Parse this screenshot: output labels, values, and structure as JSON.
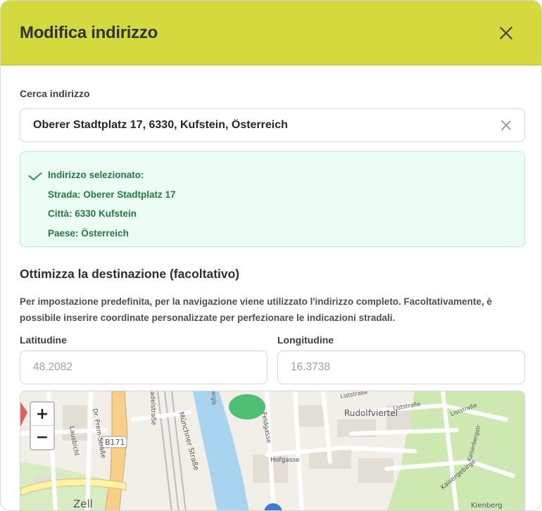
{
  "header": {
    "title": "Modifica indirizzo"
  },
  "search": {
    "label": "Cerca indirizzo",
    "value": "Oberer Stadtplatz 17, 6330, Kufstein, Österreich"
  },
  "selected": {
    "heading": "Indirizzo selezionato:",
    "street": "Strada: Oberer Stadtplatz 17",
    "city": "Città: 6330 Kufstein",
    "country": "Paese: Österreich"
  },
  "refine": {
    "title": "Ottimizza la destinazione (facoltativo)",
    "description": "Per impostazione predefinita, per la navigazione viene utilizzato l'indirizzo completo. Facoltativamente, è possibile inserire coordinate personalizzate per perfezionare le indicazioni stradali.",
    "latitude_label": "Latitudine",
    "latitude_placeholder": "48.2082",
    "longitude_label": "Longitudine",
    "longitude_placeholder": "16.3738"
  },
  "map": {
    "zoom_in": "+",
    "zoom_out": "−",
    "labels": {
      "road_b171": "B171",
      "rudolfviertel": "Rudolfviertel",
      "zell": "Zell",
      "kienberg": "Kienberg",
      "hofgasse": "Hofgasse",
      "feldgasse": "Feldgasse",
      "muenchner": "Münchner Straße",
      "prem": "Dr. Prem-Straße",
      "lausbichl": "Lausbichl",
      "stadtstr": "adelstraße",
      "liststrasse_1": "Liststraße",
      "liststrasse_2": "Liststraße",
      "lisststrasse": "Liststraße",
      "kaisergebirge": "Kaisergebirge",
      "kaiser": "Kaiserbergstr",
      "bergls": "ergls"
    },
    "colors": {
      "river": "#a8d4f0",
      "park": "#cde8b0",
      "road_major": "#f8cf8a",
      "pitch": "#4fbf73"
    }
  }
}
